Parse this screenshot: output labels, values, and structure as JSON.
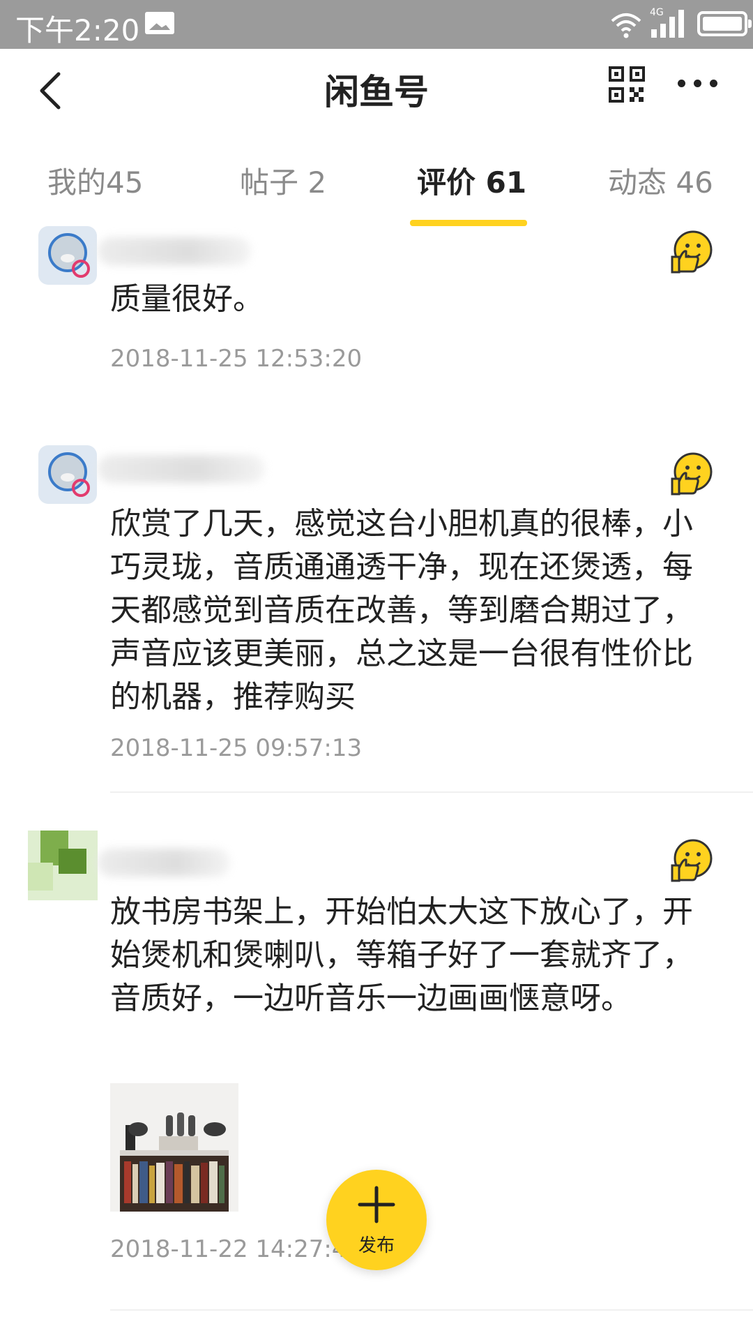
{
  "status_bar": {
    "time": "下午2:20",
    "network": "4G",
    "icons": [
      "image-notification-icon",
      "wifi-icon",
      "signal-icon",
      "battery-icon"
    ]
  },
  "header": {
    "title": "闲鱼号",
    "icons": [
      "back-icon",
      "qr-code-icon",
      "more-icon"
    ]
  },
  "tabs": [
    {
      "label": "我的45",
      "active": false
    },
    {
      "label": "帖子 2",
      "active": false
    },
    {
      "label": "评价 61",
      "active": true
    },
    {
      "label": "动态 46",
      "active": false
    }
  ],
  "colors": {
    "accent": "#ffd21f",
    "status_bar": "#9b9b9b",
    "text": "#222222",
    "muted": "#9a9a9a"
  },
  "reviews": [
    {
      "text": "质量很好。",
      "time": "2018-11-25 12:53:20",
      "rating_icon": "thumbs-up-emoji-icon"
    },
    {
      "text": "欣赏了几天，感觉这台小胆机真的很棒，小巧灵珑，音质通通透干净，现在还煲透，每天都感觉到音质在改善，等到磨合期过了，声音应该更美丽，总之这是一台很有性价比的机器，推荐购买",
      "time": "2018-11-25 09:57:13",
      "rating_icon": "thumbs-up-emoji-icon"
    },
    {
      "text": "放书房书架上，开始怕太大这下放心了，开始煲机和煲喇叭，等箱子好了一套就齐了，音质好，一边听音乐一边画画惬意呀。",
      "time": "2018-11-22 14:27:48",
      "rating_icon": "thumbs-up-emoji-icon",
      "photo": "tube-amplifier-on-bookshelf-photo"
    }
  ],
  "fab": {
    "label": "发布",
    "icon": "plus-icon"
  }
}
